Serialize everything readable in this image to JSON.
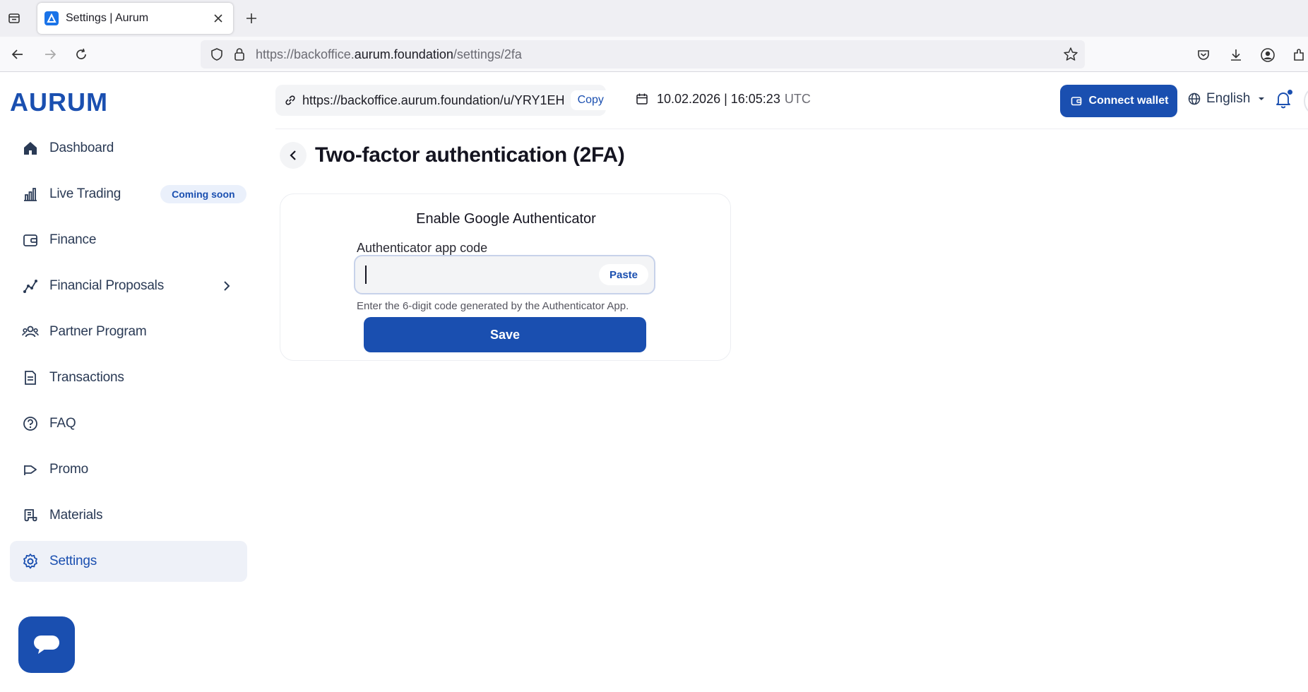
{
  "browser": {
    "tab_title": "Settings | Aurum",
    "url_prefix": "https://backoffice.",
    "url_host": "aurum.foundation",
    "url_path": "/settings/2fa"
  },
  "header": {
    "logo": "AURUM",
    "referral_url": "https://backoffice.aurum.foundation/u/YRY1EH",
    "copy_label": "Copy",
    "datetime": "10.02.2026 | 16:05:23",
    "timezone": "UTC",
    "connect_wallet_label": "Connect wallet",
    "language": "English"
  },
  "sidebar": {
    "items": [
      {
        "label": "Dashboard",
        "icon": "home-icon"
      },
      {
        "label": "Live Trading",
        "icon": "bar-chart-icon",
        "badge": "Coming soon"
      },
      {
        "label": "Finance",
        "icon": "wallet-icon"
      },
      {
        "label": "Financial Proposals",
        "icon": "line-chart-icon"
      },
      {
        "label": "Partner Program",
        "icon": "users-icon"
      },
      {
        "label": "Transactions",
        "icon": "document-icon"
      },
      {
        "label": "FAQ",
        "icon": "help-circle-icon"
      },
      {
        "label": "Promo",
        "icon": "megaphone-icon"
      },
      {
        "label": "Materials",
        "icon": "scroll-icon"
      },
      {
        "label": "Settings",
        "icon": "gear-icon",
        "active": true
      }
    ]
  },
  "page": {
    "title": "Two-factor authentication (2FA)"
  },
  "card": {
    "title": "Enable Google Authenticator",
    "field_label": "Authenticator app code",
    "input_value": "",
    "paste_label": "Paste",
    "hint": "Enter the 6-digit code generated by the Authenticator App.",
    "save_label": "Save"
  },
  "colors": {
    "brand": "#1a4fb0",
    "active_bg": "#eef1f8",
    "badge_bg": "#eaf0fb"
  }
}
